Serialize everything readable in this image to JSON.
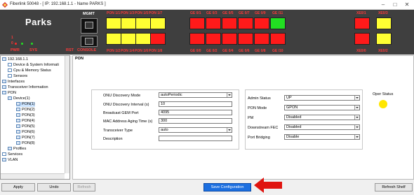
{
  "window": {
    "title": "Fiberlink 50048 - [ IP: 192.168.1.1 - Name PARKS ]",
    "controls": [
      "–",
      "□",
      "✕"
    ]
  },
  "device": {
    "brand": "Parks",
    "led_labels": [
      "PWR",
      "SYS",
      "RST",
      "CONSOLE"
    ],
    "led_values": [
      "0",
      "1"
    ],
    "mgmt_label": "MGMT",
    "pon_top": [
      "PON 1/1",
      "PON 1/3",
      "PON 1/5",
      "PON 1/7"
    ],
    "pon_bottom": [
      "PON 1/2",
      "PON 1/4",
      "PON 1/6",
      "PON 1/8"
    ],
    "ge_top": [
      "GE 0/1",
      "GE 0/3",
      "GE 0/5",
      "GE 0/7",
      "GE 0/9",
      "GE /11"
    ],
    "ge_bottom": [
      "GE 0/0",
      "GE 0/2",
      "GE 0/4",
      "GE 0/6",
      "GE 0/8",
      "GE /10"
    ],
    "xe_top": [
      "XE0/1",
      "XE0/3"
    ],
    "xe_bottom": [
      "XE0/0",
      "XE0/2"
    ],
    "colors": {
      "yellow": "#ffff33",
      "red": "#ff1a1a",
      "green": "#22e022"
    }
  },
  "tree": {
    "items": [
      {
        "label": "192.168.1.1",
        "indent": 0
      },
      {
        "label": "Device & System Informati",
        "indent": 1
      },
      {
        "label": "Cpu & Memory Status",
        "indent": 1
      },
      {
        "label": "Sensors",
        "indent": 1
      },
      {
        "label": "Interfaces",
        "indent": 0
      },
      {
        "label": "Transceiver Information",
        "indent": 0
      },
      {
        "label": "PON",
        "indent": 0
      },
      {
        "label": "Device(1)",
        "indent": 1
      },
      {
        "label": "PON(1)",
        "indent": 2
      },
      {
        "label": "PON(2)",
        "indent": 2
      },
      {
        "label": "PON(3)",
        "indent": 2
      },
      {
        "label": "PON(4)",
        "indent": 2
      },
      {
        "label": "PON(5)",
        "indent": 2
      },
      {
        "label": "PON(6)",
        "indent": 2
      },
      {
        "label": "PON(7)",
        "indent": 2
      },
      {
        "label": "PON(8)",
        "indent": 2
      },
      {
        "label": "Profiles",
        "indent": 1
      },
      {
        "label": "Services",
        "indent": 0
      },
      {
        "label": "VLAN",
        "indent": 0
      }
    ]
  },
  "panel": {
    "title": "PON",
    "left_fields": [
      {
        "label": "ONU Discovery Mode",
        "value": "autoPeriodic",
        "type": "select"
      },
      {
        "label": "ONU Discovery Interval (s)",
        "value": "10",
        "type": "input"
      },
      {
        "label": "Broadcast GEM Port",
        "value": "4095",
        "type": "input"
      },
      {
        "label": "MAC Address Aging Time (s)",
        "value": "300",
        "type": "input"
      },
      {
        "label": "Transceiver Type",
        "value": "auto",
        "type": "select"
      },
      {
        "label": "Description",
        "value": "",
        "type": "input"
      }
    ],
    "right_fields": [
      {
        "label": "Admin Status",
        "value": "UP"
      },
      {
        "label": "PON Mode",
        "value": "GPON"
      },
      {
        "label": "PM",
        "value": "Disabled"
      },
      {
        "label": "Downstream FEC",
        "value": "Disabled"
      },
      {
        "label": "Port Bridging",
        "value": "Disable"
      }
    ],
    "oper_status_label": "Oper Status",
    "oper_status_color": "#ffe600"
  },
  "buttons": {
    "apply": "Apply",
    "undo": "Undo",
    "refresh": "Refresh",
    "save": "Save Configuration",
    "refresh_shelf": "Refresh Shelf"
  }
}
